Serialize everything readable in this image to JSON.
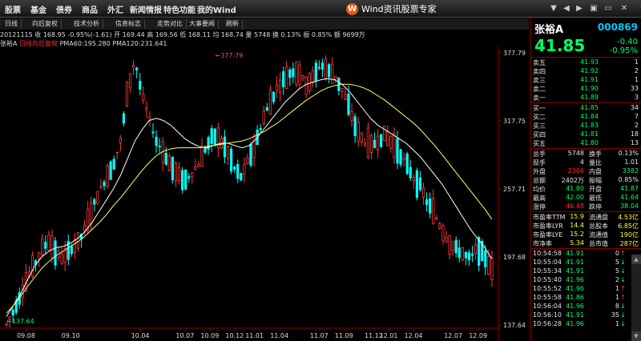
{
  "menu": {
    "items": [
      "股票",
      "基金",
      "债券",
      "商品",
      "外汇",
      "新闻情报",
      "特色功能",
      "我的Wind"
    ],
    "brand": "Wind资讯股票专家",
    "brand_logo": "W"
  },
  "window_controls": [
    "▼",
    "◀",
    "▶",
    "▣",
    "▭",
    "✕"
  ],
  "toolbar": {
    "buttons": [
      "日线",
      "向后复权",
      "技术分析",
      "信息标志",
      "走势对比",
      "大事要闻",
      "刷新"
    ]
  },
  "infoline": {
    "text": "20121115 收 168.95 -0.95%(-1.61) 开 169.44 高 169.56 低 168.11 均 168.74 量 5748 换 0.13% 振 0.85% 额 9699万"
  },
  "legend": {
    "name": "张裕A",
    "mode": "日线向后复权",
    "ma_text": "PMA60:195.280 PMA120:231.641"
  },
  "chart_data": {
    "type": "candlestick",
    "y_ticks": [
      "377.79",
      "317.75",
      "257.71",
      "197.68",
      "137.64"
    ],
    "y_tick_values": [
      377.79,
      317.75,
      257.71,
      197.68,
      137.64
    ],
    "ylim": [
      137.64,
      377.79
    ],
    "x_ticks": [
      "09.08",
      "09.10",
      "10.04",
      "10.07",
      "10.09",
      "10.12",
      "11.01",
      "11.04",
      "11.07",
      "11.09",
      "11.12",
      "12.01",
      "12.04",
      "12.07",
      "12.09"
    ],
    "x_tick_positions": [
      0.05,
      0.14,
      0.28,
      0.37,
      0.42,
      0.47,
      0.51,
      0.56,
      0.64,
      0.69,
      0.75,
      0.78,
      0.83,
      0.91,
      0.96
    ],
    "annotations": [
      "377.79",
      "137.64"
    ],
    "close_trend": [
      138,
      150,
      165,
      180,
      192,
      205,
      212,
      200,
      196,
      205,
      210,
      222,
      240,
      255,
      268,
      280,
      300,
      345,
      372,
      340,
      320,
      300,
      290,
      278,
      270,
      265,
      272,
      280,
      295,
      305,
      300,
      290,
      275,
      268,
      285,
      300,
      320,
      335,
      348,
      355,
      362,
      360,
      350,
      356,
      368,
      362,
      358,
      345,
      330,
      310,
      300,
      295,
      300,
      305,
      298,
      290,
      280,
      268,
      260,
      245,
      235,
      222,
      210,
      205,
      200,
      196,
      206,
      198,
      186
    ],
    "ma60_trend": [
      145,
      155,
      165,
      178,
      190,
      198,
      203,
      206,
      207,
      210,
      214,
      220,
      228,
      238,
      248,
      258,
      270,
      285,
      300,
      310,
      318,
      320,
      318,
      314,
      308,
      302,
      298,
      295,
      294,
      296,
      298,
      298,
      296,
      294,
      296,
      302,
      310,
      318,
      326,
      334,
      340,
      346,
      350,
      352,
      354,
      355,
      354,
      350,
      344,
      336,
      328,
      320,
      314,
      310,
      306,
      302,
      298,
      292,
      286,
      278,
      270,
      262,
      252,
      242,
      232,
      222,
      214,
      206,
      196
    ],
    "ma120_trend": [
      148,
      155,
      163,
      172,
      180,
      188,
      194,
      199,
      203,
      207,
      211,
      216,
      222,
      228,
      235,
      243,
      250,
      258,
      266,
      274,
      281,
      287,
      291,
      293,
      294,
      294,
      294,
      294,
      295,
      296,
      297,
      298,
      299,
      300,
      302,
      305,
      308,
      312,
      316,
      321,
      326,
      331,
      336,
      340,
      344,
      347,
      349,
      350,
      350,
      349,
      347,
      344,
      340,
      336,
      331,
      326,
      321,
      316,
      310,
      303,
      296,
      288,
      280,
      272,
      264,
      256,
      248,
      240,
      231
    ]
  },
  "panel": {
    "name": "张裕A",
    "code": "000869",
    "price": "41.85",
    "change": "-0.40",
    "change_pct": "-0.95%",
    "asks": [
      {
        "label": "卖五",
        "price": "41.93",
        "vol": "1"
      },
      {
        "label": "卖四",
        "price": "41.92",
        "vol": "2"
      },
      {
        "label": "卖三",
        "price": "41.91",
        "vol": "1"
      },
      {
        "label": "卖二",
        "price": "41.90",
        "vol": "33"
      },
      {
        "label": "卖一",
        "price": "41.89",
        "vol": "3"
      }
    ],
    "bids": [
      {
        "label": "买一",
        "price": "41.85",
        "vol": "34"
      },
      {
        "label": "买二",
        "price": "41.84",
        "vol": "7"
      },
      {
        "label": "买三",
        "price": "41.83",
        "vol": "2"
      },
      {
        "label": "买四",
        "price": "41.81",
        "vol": "18"
      },
      {
        "label": "买五",
        "price": "41.80",
        "vol": "13"
      }
    ],
    "stats": [
      {
        "l1": "总手",
        "v1": "5748",
        "c1": "white",
        "l2": "换手",
        "v2": "0.13%",
        "c2": "white"
      },
      {
        "l1": "现手",
        "v1": "4",
        "c1": "white",
        "l2": "量比",
        "v2": "1.01",
        "c2": "white"
      },
      {
        "l1": "外盘",
        "v1": "2366",
        "c1": "red",
        "l2": "内盘",
        "v2": "3382",
        "c2": "green"
      },
      {
        "l1": "总额",
        "v1": "2402万",
        "c1": "white",
        "l2": "振幅",
        "v2": "0.85%",
        "c2": "white"
      },
      {
        "l1": "均价",
        "v1": "41.80",
        "c1": "green",
        "l2": "开盘",
        "v2": "41.87",
        "c2": "green"
      },
      {
        "l1": "最高",
        "v1": "42.00",
        "c1": "green",
        "l2": "最低",
        "v2": "41.64",
        "c2": "green"
      },
      {
        "l1": "涨停",
        "v1": "46.48",
        "c1": "red",
        "l2": "跌停",
        "v2": "38.04",
        "c2": "green"
      }
    ],
    "ratios": [
      {
        "l1": "市盈率TTM",
        "v1": "15.9",
        "l2": "流通盘",
        "v2": "4.53亿"
      },
      {
        "l1": "市盈率LYR",
        "v1": "14.4",
        "l2": "总股本",
        "v2": "6.85亿"
      },
      {
        "l1": "市盈率LYE",
        "v1": "15.2",
        "l2": "流通值",
        "v2": "190亿"
      },
      {
        "l1": "市净率",
        "v1": "5.34",
        "l2": "总市值",
        "v2": "287亿"
      }
    ],
    "ticks": [
      {
        "time": "10:54:58",
        "price": "41.91",
        "vol": "0",
        "dir": "↑",
        "dcolor": "red"
      },
      {
        "time": "10:55:04",
        "price": "41.91",
        "vol": "5",
        "dir": "↓",
        "dcolor": "green"
      },
      {
        "time": "10:55:34",
        "price": "41.91",
        "vol": "5",
        "dir": "↓",
        "dcolor": "green"
      },
      {
        "time": "10:55:40",
        "price": "41.96",
        "vol": "2",
        "dir": "↓",
        "dcolor": "green"
      },
      {
        "time": "10:55:52",
        "price": "41.96",
        "vol": "1",
        "dir": "↑",
        "dcolor": "red"
      },
      {
        "time": "10:55:58",
        "price": "41.86",
        "vol": "1",
        "dir": "↑",
        "dcolor": "red"
      },
      {
        "time": "10:56:04",
        "price": "41.96",
        "vol": "8",
        "dir": "↓",
        "dcolor": "green"
      },
      {
        "time": "10:56:10",
        "price": "41.91",
        "vol": "35",
        "dir": "↓",
        "dcolor": "green"
      },
      {
        "time": "10:56:28",
        "price": "41.96",
        "vol": "1",
        "dir": "↓",
        "dcolor": "green"
      }
    ]
  }
}
